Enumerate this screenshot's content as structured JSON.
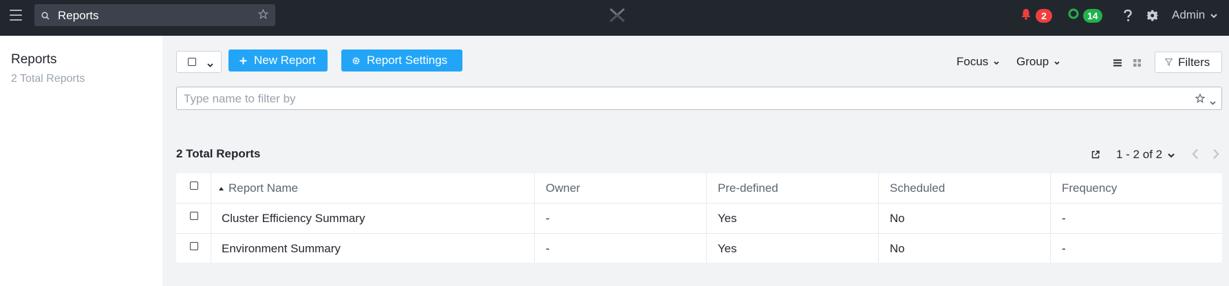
{
  "topbar": {
    "search_value": "Reports",
    "notifications_count": "2",
    "tasks_count": "14",
    "user_label": "Admin",
    "icons": [
      "hamburger-icon",
      "search-icon",
      "star-icon",
      "logo-icon",
      "bell-icon",
      "circle-status-icon",
      "help-icon",
      "gear-icon",
      "chevron-down-icon"
    ]
  },
  "leftpanel": {
    "title": "Reports",
    "subtitle": "2 Total Reports"
  },
  "toolbar": {
    "new_report_label": "New Report",
    "report_settings_label": "Report Settings",
    "focus_label": "Focus",
    "group_label": "Group",
    "filters_label": "Filters"
  },
  "filter": {
    "placeholder": "Type name to filter by"
  },
  "table": {
    "total_label": "2 Total Reports",
    "pagination": "1 - 2 of 2",
    "columns": [
      "Report Name",
      "Owner",
      "Pre-defined",
      "Scheduled",
      "Frequency"
    ],
    "rows": [
      [
        "Cluster Efficiency Summary",
        "-",
        "Yes",
        "No",
        "-"
      ],
      [
        "Environment Summary",
        "-",
        "Yes",
        "No",
        "-"
      ]
    ]
  },
  "colors": {
    "topbar_bg": "#22272e",
    "accent_blue": "#22a5f7",
    "badge_red": "#ee3f3f",
    "badge_green": "#22b14c"
  }
}
